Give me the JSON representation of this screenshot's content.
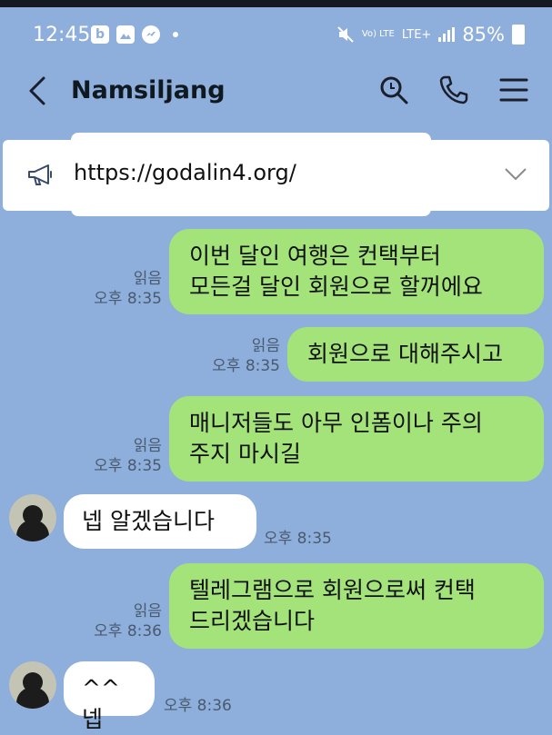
{
  "status_bar": {
    "time": "12:45",
    "net_small": "Vo) LTE",
    "lte": "LTE+",
    "battery": "85%"
  },
  "header": {
    "title": "Namsiljang"
  },
  "notice": {
    "text": "https://godalin4.org/"
  },
  "messages": [
    {
      "side": "me",
      "lines": [
        "이번 달인 여행은 컨택부터",
        "모든걸 달인 회원으로 할꺼에요"
      ],
      "read": "읽음",
      "time": "오후 8:35"
    },
    {
      "side": "me",
      "lines": [
        "회원으로 대해주시고"
      ],
      "read": "읽음",
      "time": "오후 8:35"
    },
    {
      "side": "me",
      "lines": [
        "매니저들도 아무 인폼이나 주의",
        "주지 마시길"
      ],
      "read": "읽음",
      "time": "오후 8:35"
    },
    {
      "side": "other",
      "lines": [
        "넵 알겠습니다"
      ],
      "time": "오후 8:35"
    },
    {
      "side": "me",
      "lines": [
        "텔레그램으로 회원으로써 컨택",
        "드리겠습니다"
      ],
      "read": "읽음",
      "time": "오후 8:36"
    },
    {
      "side": "other",
      "lines": [
        "^^ 넵"
      ],
      "time": "오후 8:36"
    }
  ],
  "colors": {
    "background": "#8eaedb",
    "my_bubble": "#a4e27a",
    "other_bubble": "#ffffff"
  }
}
